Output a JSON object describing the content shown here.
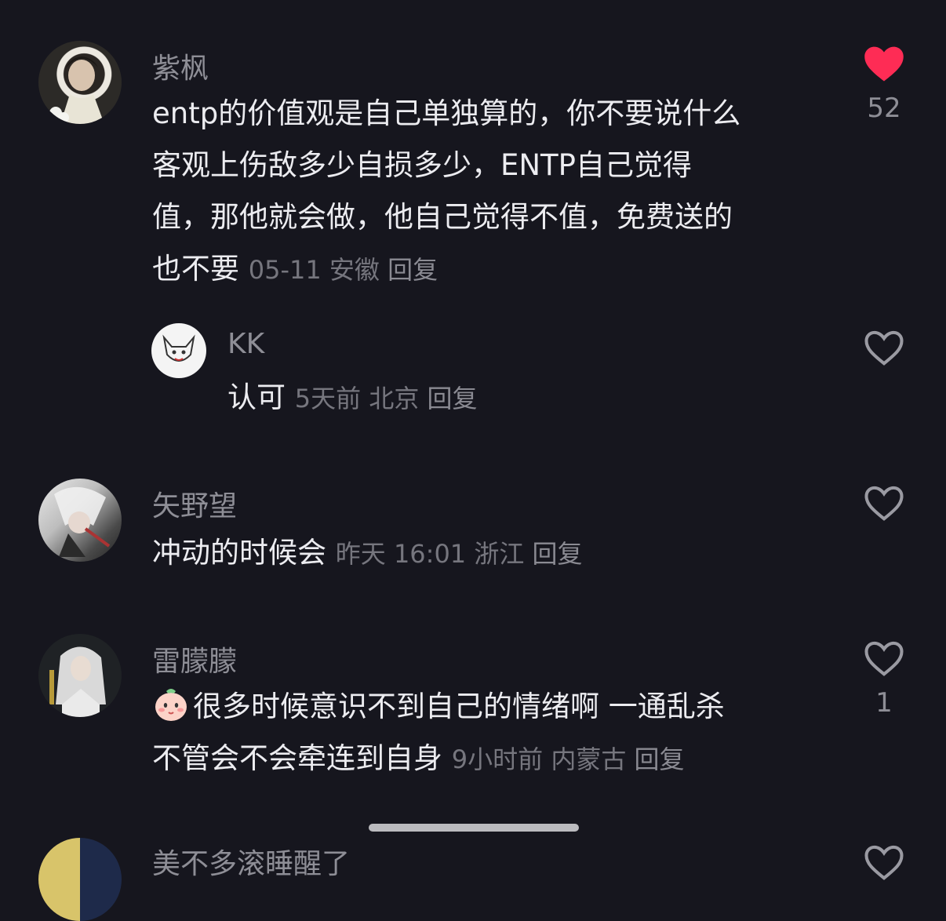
{
  "comments": [
    {
      "username": "紫枫",
      "lines": [
        "entp的价值观是自己单独算的，你不要说什么",
        "客观上伤敌多少自损多少，ENTP自己觉得",
        "值，那他就会做，他自己觉得不值，免费送的",
        "也不要"
      ],
      "time": "05-11",
      "location": "安徽",
      "reply": "回复",
      "likes": "52",
      "liked": true,
      "avatar_icon": "user-photo-avatar"
    },
    {
      "username": "KK",
      "text": "认可",
      "time": "5天前",
      "location": "北京",
      "reply": "回复",
      "likes": "",
      "liked": false,
      "avatar_icon": "sketch-cat-avatar"
    },
    {
      "username": "矢野望",
      "text": "冲动的时候会",
      "time": "昨天 16:01",
      "location": "浙江",
      "reply": "回复",
      "likes": "",
      "liked": false,
      "avatar_icon": "anime-avatar"
    },
    {
      "username": "雷朦朦",
      "lines": [
        "很多时候意识不到自己的情绪啊 一通乱杀",
        "不管会不会牵连到自身"
      ],
      "emoji": "baby-face-emoji",
      "time": "9小时前",
      "location": "内蒙古",
      "reply": "回复",
      "likes": "1",
      "liked": false,
      "avatar_icon": "white-hair-avatar"
    },
    {
      "username": "美不多滚睡醒了",
      "avatar_icon": "partial-avatar"
    }
  ],
  "colors": {
    "background": "#16161e",
    "like_active": "#fe2c55",
    "meta_text": "#76767e"
  }
}
